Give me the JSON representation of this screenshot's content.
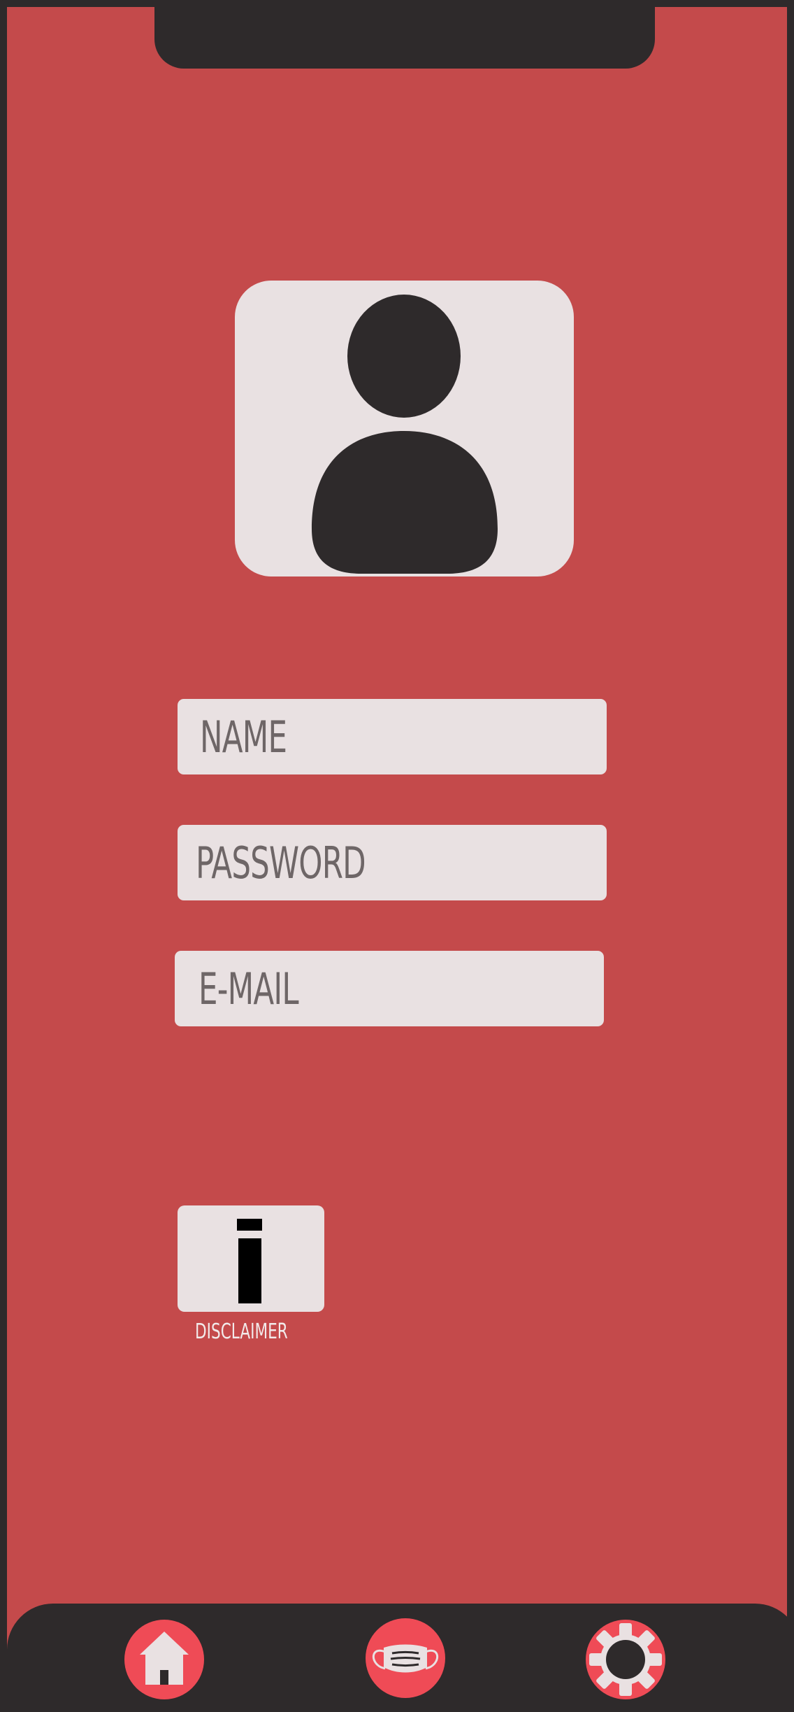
{
  "profile": {
    "avatar_icon": "user-silhouette-icon"
  },
  "form": {
    "name_placeholder": "NAME",
    "password_placeholder": "PASSWORD",
    "email_placeholder": "E-MAIL"
  },
  "disclaimer": {
    "icon": "info-icon",
    "label": "DISCLAIMER"
  },
  "nav": {
    "items": [
      {
        "icon": "home-icon"
      },
      {
        "icon": "face-mask-icon"
      },
      {
        "icon": "gear-icon"
      }
    ]
  },
  "colors": {
    "background": "#c44a4b",
    "frame": "#2e2a2b",
    "card": "#e9e1e2",
    "placeholder_text": "#6e6667",
    "nav_accent": "#ef4b56"
  }
}
